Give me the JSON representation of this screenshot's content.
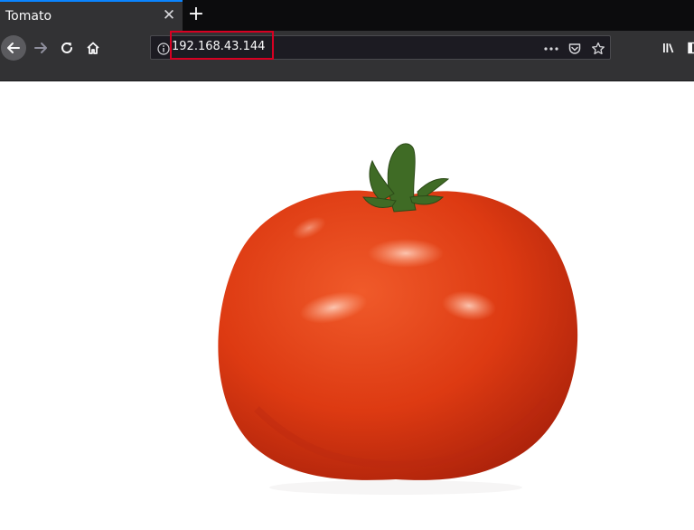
{
  "tab": {
    "title": "Tomato",
    "close_icon": "close-icon",
    "new_tab_icon": "plus-icon"
  },
  "nav": {
    "back_icon": "back-arrow-icon",
    "forward_icon": "forward-arrow-icon",
    "reload_icon": "reload-icon",
    "home_icon": "home-icon"
  },
  "urlbar": {
    "url": "192.168.43.144",
    "info_icon": "info-icon",
    "page_actions_icon": "more-dots-icon",
    "pocket_icon": "pocket-icon",
    "bookmark_icon": "star-icon",
    "highlight_color": "#d70022"
  },
  "toolbar_right": {
    "library_icon": "library-icon",
    "sidebar_icon": "sidebar-icon"
  },
  "content": {
    "image": "tomato-image"
  },
  "colors": {
    "tab_active": "#323234",
    "tab_accent": "#0a84ff",
    "toolbar": "#323234",
    "urlbar": "#1c1b22",
    "page_background": "#ffffff"
  }
}
